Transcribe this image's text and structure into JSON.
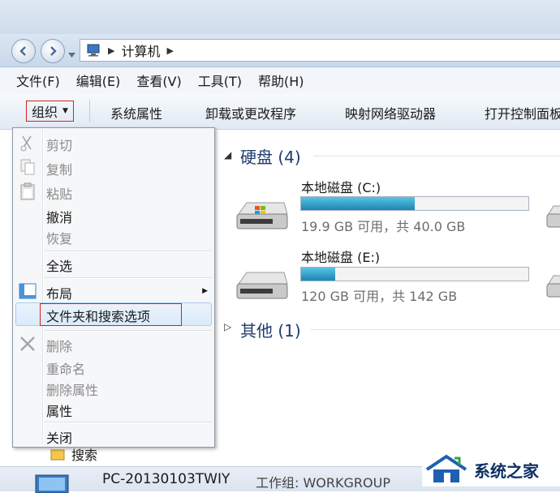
{
  "address": {
    "path": "计算机"
  },
  "menubar": [
    "文件(F)",
    "编辑(E)",
    "查看(V)",
    "工具(T)",
    "帮助(H)"
  ],
  "commands": {
    "organize": "组织",
    "items": [
      "系统属性",
      "卸载或更改程序",
      "映射网络驱动器",
      "打开控制面板"
    ]
  },
  "organize_menu": {
    "cut": "剪切",
    "copy": "复制",
    "paste": "粘贴",
    "undo": "撤消",
    "redo": "恢复",
    "select_all": "全选",
    "layout": "布局",
    "folder_options": "文件夹和搜索选项",
    "delete": "删除",
    "rename": "重命名",
    "remove_properties": "删除属性",
    "properties": "属性",
    "close": "关闭"
  },
  "groups": {
    "hard_disks": "硬盘 (4)",
    "other": "其他 (1)"
  },
  "drives": [
    {
      "name": "本地磁盘 (C:)",
      "info": "19.9 GB 可用，共 40.0 GB",
      "used_fraction": 0.5
    },
    {
      "name": "本地磁盘 (E:)",
      "info": "120 GB 可用，共 142 GB",
      "used_fraction": 0.15
    }
  ],
  "sidebar_peek": {
    "search": "搜索"
  },
  "status": {
    "pc_name": "PC-20130103TWIY",
    "workgroup": "工作组: WORKGROUP"
  },
  "watermark": {
    "text": "系统之家"
  },
  "colors": {
    "accent": "#1b86b5",
    "highlight_border": "#d62020",
    "group_heading": "#1e3a6e"
  }
}
